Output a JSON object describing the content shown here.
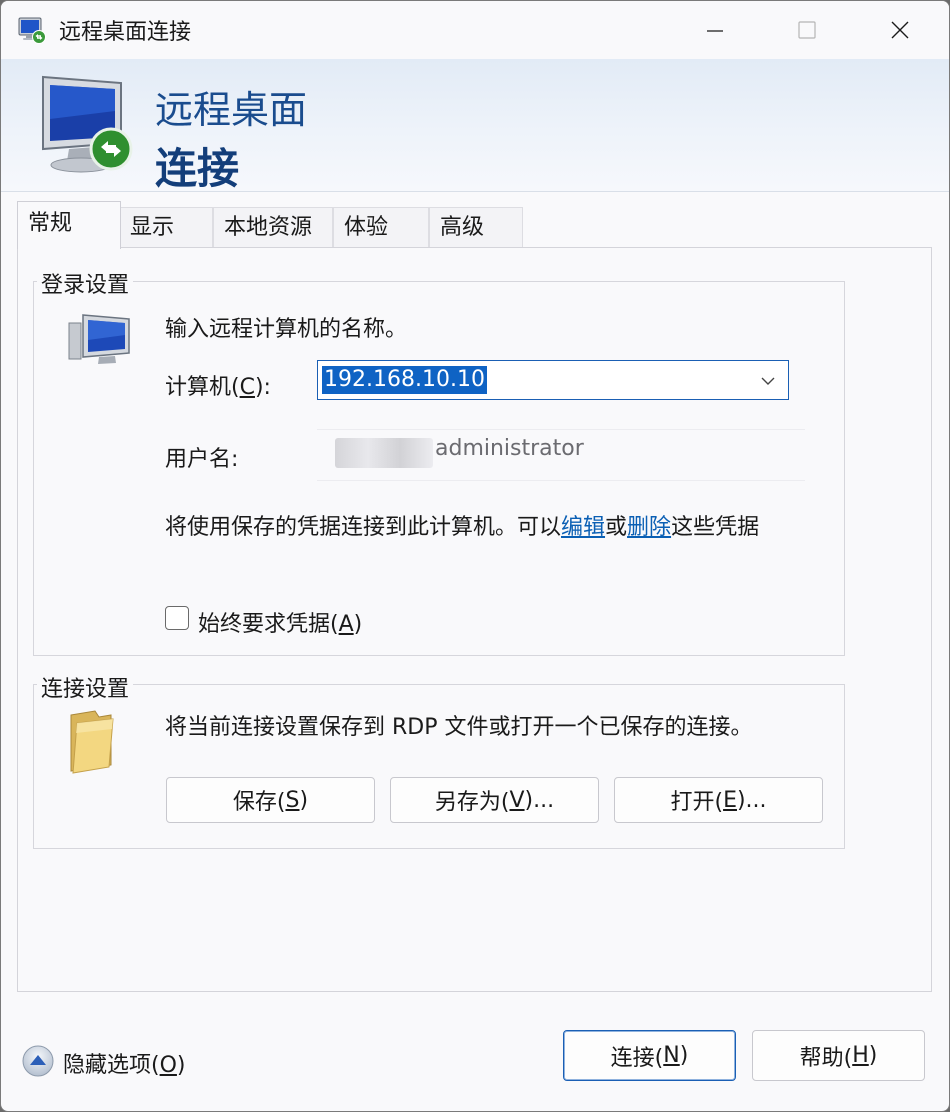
{
  "window": {
    "title": "远程桌面连接",
    "banner_line1": "远程桌面",
    "banner_line2": "连接"
  },
  "tabs": [
    {
      "label": "常规",
      "active": true
    },
    {
      "label": "显示",
      "active": false
    },
    {
      "label": "本地资源",
      "active": false
    },
    {
      "label": "体验",
      "active": false
    },
    {
      "label": "高级",
      "active": false
    }
  ],
  "login": {
    "legend": "登录设置",
    "prompt": "输入远程计算机的名称。",
    "computer_label": "计算机(",
    "computer_key": "C",
    "computer_label_end": "):",
    "computer_value": "192.168.10.10",
    "username_label": "用户名:",
    "username_value": "administrator",
    "cred_text_a": "将使用保存的凭据连接到此计算机。可以",
    "cred_edit": "编辑",
    "cred_or": "或",
    "cred_delete": "删除",
    "cred_text_b": "这些凭据",
    "always_ask_label": "始终要求凭据(",
    "always_ask_key": "A",
    "always_ask_end": ")",
    "always_ask_checked": false
  },
  "connection": {
    "legend": "连接设置",
    "description": "将当前连接设置保存到 RDP 文件或打开一个已保存的连接。",
    "save": {
      "pre": "保存(",
      "key": "S",
      "post": ")"
    },
    "save_as": {
      "pre": "另存为(",
      "key": "V",
      "post": ")..."
    },
    "open": {
      "pre": "打开(",
      "key": "E",
      "post": ")..."
    }
  },
  "footer": {
    "hide_options": {
      "pre": "隐藏选项(",
      "key": "O",
      "post": ")"
    },
    "connect": {
      "pre": "连接(",
      "key": "N",
      "post": ")"
    },
    "help": {
      "pre": "帮助(",
      "key": "H",
      "post": ")"
    }
  },
  "colors": {
    "accent": "#0f63c4",
    "link": "#0a5fb4",
    "banner_text": "#1a4c8e"
  }
}
